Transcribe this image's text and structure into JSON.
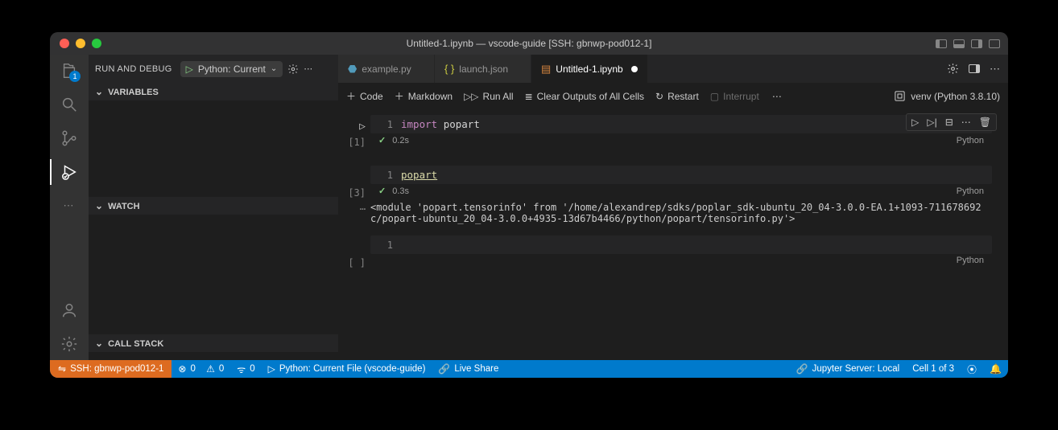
{
  "window": {
    "title": "Untitled-1.ipynb — vscode-guide [SSH: gbnwp-pod012-1]"
  },
  "activity": {
    "explorer_badge": "1"
  },
  "sidebar": {
    "title": "RUN AND DEBUG",
    "config": "Python: Current",
    "sections": {
      "variables": "VARIABLES",
      "watch": "WATCH",
      "callstack": "CALL STACK"
    }
  },
  "tabs": [
    {
      "label": "example.py",
      "kind": "py",
      "active": false
    },
    {
      "label": "launch.json",
      "kind": "json",
      "active": false
    },
    {
      "label": "Untitled-1.ipynb",
      "kind": "nb",
      "active": true,
      "dirty": true
    }
  ],
  "nb_toolbar": {
    "code": "Code",
    "markdown": "Markdown",
    "run_all": "Run All",
    "clear": "Clear Outputs of All Cells",
    "restart": "Restart",
    "interrupt": "Interrupt",
    "kernel": "venv (Python 3.8.10)"
  },
  "cells": {
    "c1": {
      "play": "▷",
      "exec": "[1]",
      "line_no": "1",
      "kw": "import",
      "id": "popart",
      "time": "0.2s",
      "lang": "Python"
    },
    "c2": {
      "exec": "[3]",
      "line_no": "1",
      "link": "popart",
      "time": "0.3s",
      "lang": "Python",
      "out_gutter": "⋯",
      "output": "<module 'popart.tensorinfo' from '/home/alexandrep/sdks/poplar_sdk-ubuntu_20_04-3.0.0-EA.1+1093-711678692c/popart-ubuntu_20_04-3.0.0+4935-13d67b4466/python/popart/tensorinfo.py'>"
    },
    "c3": {
      "exec": "[ ]",
      "line_no": "1",
      "lang": "Python"
    }
  },
  "statusbar": {
    "remote": "SSH: gbnwp-pod012-1",
    "errors": "0",
    "warnings": "0",
    "ports": "0",
    "debug": "Python: Current File (vscode-guide)",
    "live": "Live Share",
    "jupyter": "Jupyter Server: Local",
    "cellpos": "Cell 1 of 3"
  }
}
